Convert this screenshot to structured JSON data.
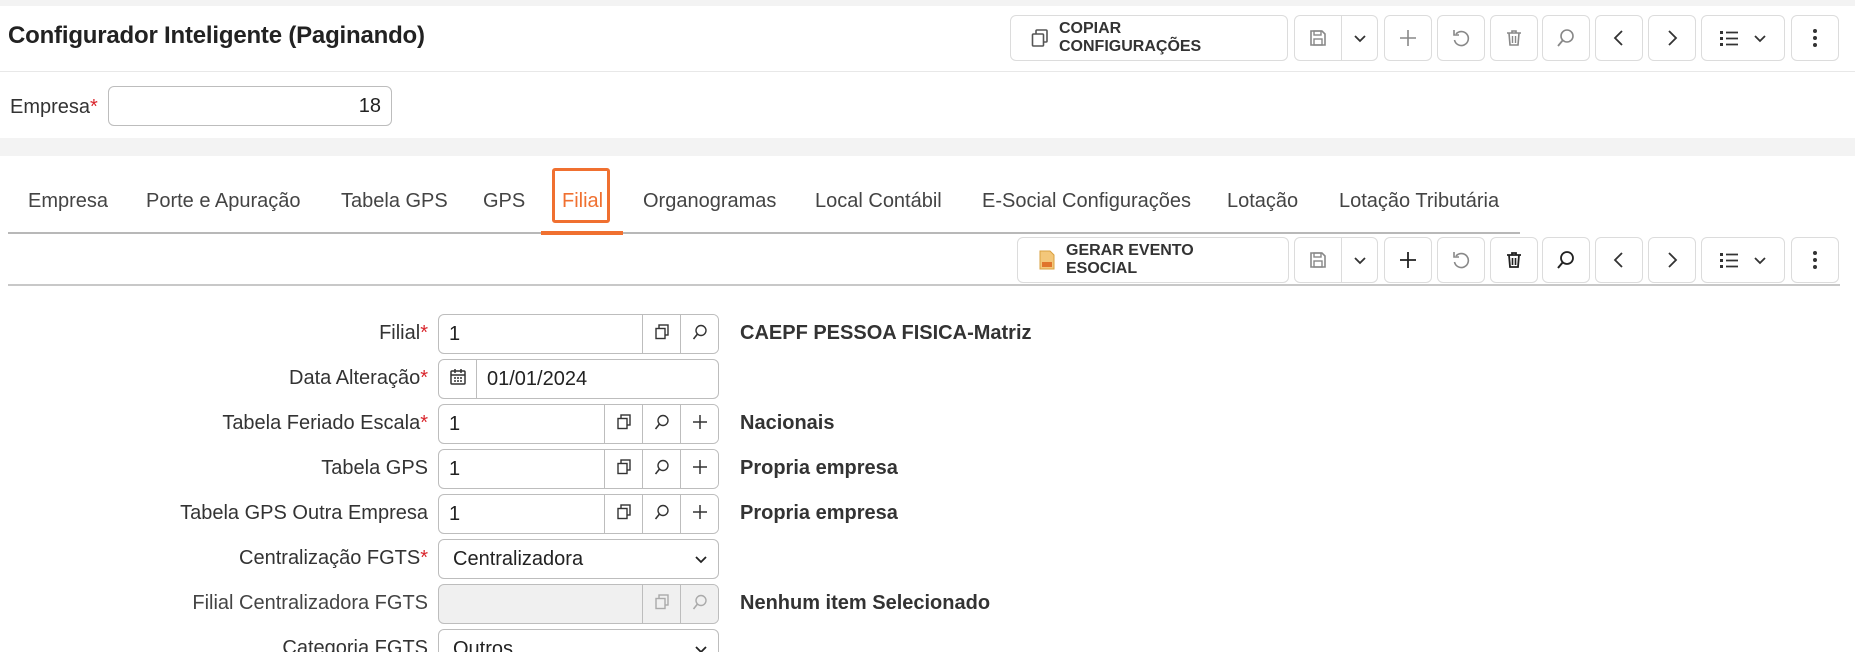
{
  "header": {
    "title": "Configurador Inteligente  (Paginando)",
    "copy_button_label": "COPIAR CONFIGURAÇÕES"
  },
  "empresa": {
    "label": "Empresa",
    "required_mark": "*",
    "value": "18"
  },
  "tabs": [
    {
      "label": "Empresa",
      "active": false
    },
    {
      "label": "Porte e Apuração",
      "active": false
    },
    {
      "label": "Tabela GPS",
      "active": false
    },
    {
      "label": "GPS",
      "active": false
    },
    {
      "label": "Filial",
      "active": true
    },
    {
      "label": "Organogramas",
      "active": false
    },
    {
      "label": "Local Contábil",
      "active": false
    },
    {
      "label": "E-Social Configurações",
      "active": false
    },
    {
      "label": "Lotação",
      "active": false
    },
    {
      "label": "Lotação Tributária",
      "active": false
    }
  ],
  "subtoolbar": {
    "esocial_button_label": "GERAR EVENTO ESOCIAL"
  },
  "form": {
    "filial": {
      "label": "Filial",
      "value": "1",
      "desc": "CAEPF PESSOA FISICA-Matriz"
    },
    "data_alteracao": {
      "label": "Data Alteração",
      "value": "01/01/2024"
    },
    "tabela_feriado": {
      "label": "Tabela Feriado Escala",
      "value": "1",
      "desc": "Nacionais"
    },
    "tabela_gps": {
      "label": "Tabela GPS",
      "value": "1",
      "desc": "Propria empresa"
    },
    "tabela_gps_outra": {
      "label": "Tabela GPS Outra Empresa",
      "value": "1",
      "desc": "Propria empresa"
    },
    "centralizacao": {
      "label": "Centralização FGTS",
      "value": "Centralizadora"
    },
    "filial_centralizadora": {
      "label": "Filial Centralizadora FGTS",
      "value": "",
      "desc": "Nenhum item Selecionado"
    },
    "categoria": {
      "label": "Categoria FGTS",
      "value": "Outros"
    }
  },
  "colors": {
    "accent": "#f07030",
    "required": "#d9252c",
    "border": "#bdbdbd"
  }
}
